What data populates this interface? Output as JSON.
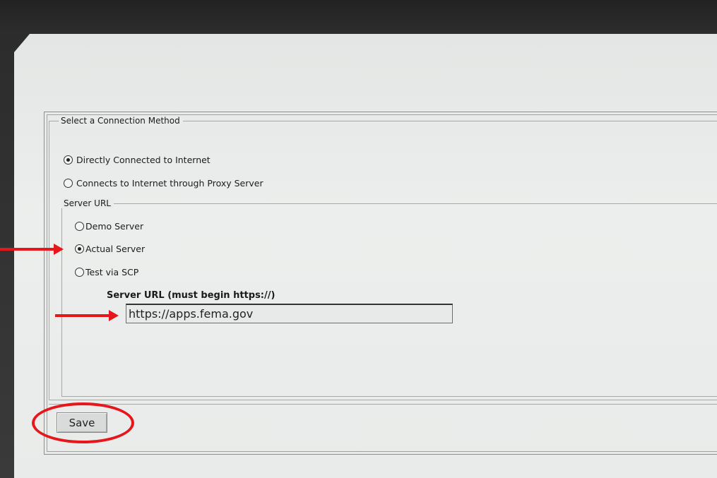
{
  "connection": {
    "legend": "Select a Connection Method",
    "options": [
      {
        "label": "Directly Connected to Internet",
        "selected": true
      },
      {
        "label": "Connects to Internet through Proxy Server",
        "selected": false
      }
    ]
  },
  "server": {
    "legend": "Server URL",
    "options": [
      {
        "label": "Demo Server",
        "selected": false
      },
      {
        "label": "Actual Server",
        "selected": true
      },
      {
        "label": "Test via SCP",
        "selected": false
      }
    ],
    "url_label": "Server URL (must begin https://)",
    "url_value": "https://apps.fema.gov"
  },
  "actions": {
    "save_label": "Save"
  },
  "annotation_color": "#e6161b"
}
